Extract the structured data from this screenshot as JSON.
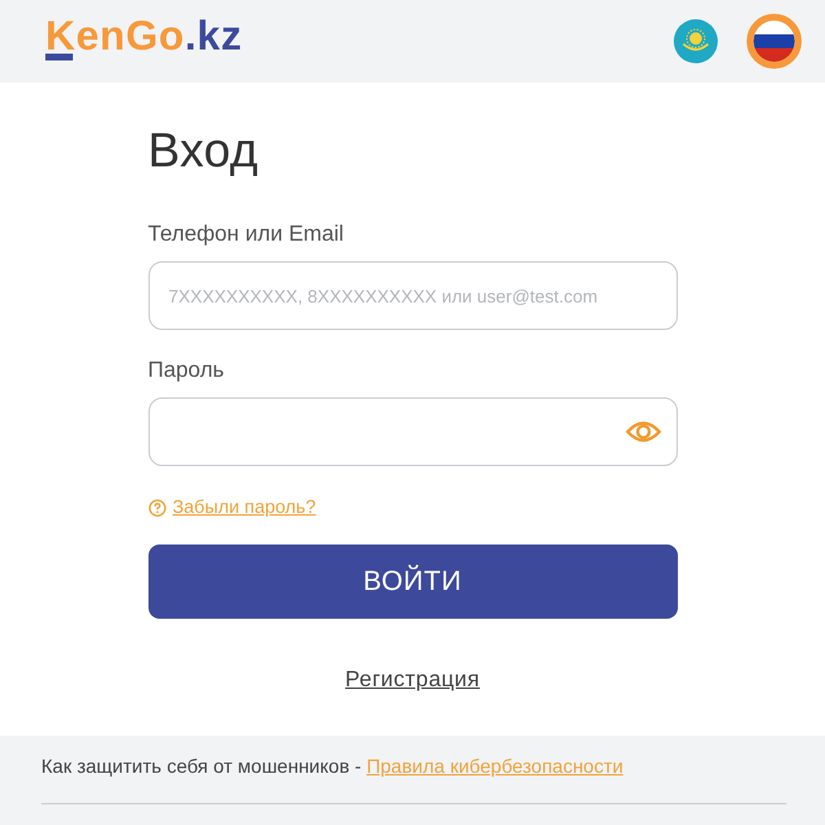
{
  "header": {
    "logo": {
      "name": "KenGo",
      "domain": ".kz"
    },
    "languages": [
      {
        "kind": "kz",
        "selected": false
      },
      {
        "kind": "ru",
        "selected": true
      }
    ]
  },
  "login": {
    "title": "Вход",
    "fields": [
      {
        "kind": "text",
        "label": "Телефон или Email",
        "placeholder": "7XXXXXXXXXX, 8XXXXXXXXXX или user@test.com"
      },
      {
        "kind": "password",
        "label": "Пароль"
      }
    ],
    "forgot_link": "Забыли пароль?",
    "submit": "ВОЙТИ",
    "register_link": "Регистрация"
  },
  "footer": {
    "text": "Как защитить себя от мошенников -",
    "link": "Правила кибербезопасности"
  }
}
